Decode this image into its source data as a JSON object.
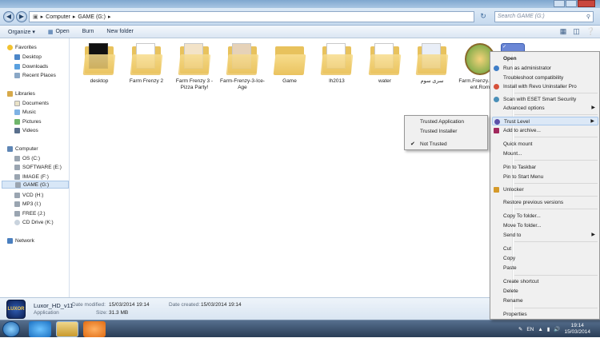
{
  "address": {
    "path": [
      "Computer",
      "GAME (G:)"
    ],
    "search_placeholder": "Search GAME (G:)"
  },
  "toolbar": {
    "organize": "Organize ▾",
    "open": "Open",
    "burn": "Burn",
    "new_folder": "New folder"
  },
  "sidebar": {
    "favorites": "Favorites",
    "desktop": "Desktop",
    "downloads": "Downloads",
    "recent": "Recent Places",
    "libraries": "Libraries",
    "documents": "Documents",
    "music": "Music",
    "pictures": "Pictures",
    "videos": "Videos",
    "computer": "Computer",
    "os": "OS (C:)",
    "software": "SOFTWARE (E:)",
    "image": "IMAGE (F:)",
    "game": "GAME (G:)",
    "vcd": "VCD (H:)",
    "mp3": "MP3 (I:)",
    "free": "FREE (J:)",
    "cd": "CD Drive (K:)",
    "network": "Network"
  },
  "files": [
    "desktop",
    "Farm Frenzy 2",
    "Farm Frenzy 3 - Pizza Party!",
    "Farm-Frenzy-3-Ice-Age",
    "Game",
    "lh2013",
    "water",
    "سری سوم",
    "Farm.Frenzy.3.Am ent.Rom"
  ],
  "status": {
    "name": "Luxor_HD_v11",
    "modified_label": "Date modified:",
    "modified": "15/03/2014 19:14",
    "created_label": "Date created:",
    "created": "15/03/2014 19:14",
    "type": "Application",
    "size_label": "Size:",
    "size": "31.3 MB",
    "icon_text": "LUXOR"
  },
  "menu": {
    "open": "Open",
    "run_admin": "Run as administrator",
    "troubleshoot": "Troubleshoot compatibility",
    "revo": "Install with Revo Uninstaller Pro",
    "eset": "Scan with ESET Smart Security",
    "advanced": "Advanced options",
    "trust": "Trust Level",
    "archive": "Add to archive...",
    "quick_mount": "Quick mount",
    "mount": "Mount...",
    "pin_taskbar": "Pin to Taskbar",
    "pin_start": "Pin to Start Menu",
    "unlocker": "Unlocker",
    "restore": "Restore previous versions",
    "copy_folder": "Copy To folder...",
    "move_folder": "Move To folder...",
    "send_to": "Send to",
    "cut": "Cut",
    "copy": "Copy",
    "paste": "Paste",
    "shortcut": "Create shortcut",
    "delete": "Delete",
    "rename": "Rename",
    "properties": "Properties"
  },
  "submenu": {
    "trusted_app": "Trusted Application",
    "trusted_installer": "Trusted Installer",
    "not_trusted": "Not Trusted",
    "check": "✔"
  },
  "tray": {
    "lang": "EN",
    "time": "19:14",
    "date": "15/03/2014"
  },
  "colors": {
    "accent": "#3a6ea5",
    "folder": "#eac35f",
    "highlight": "#dce8f6"
  }
}
